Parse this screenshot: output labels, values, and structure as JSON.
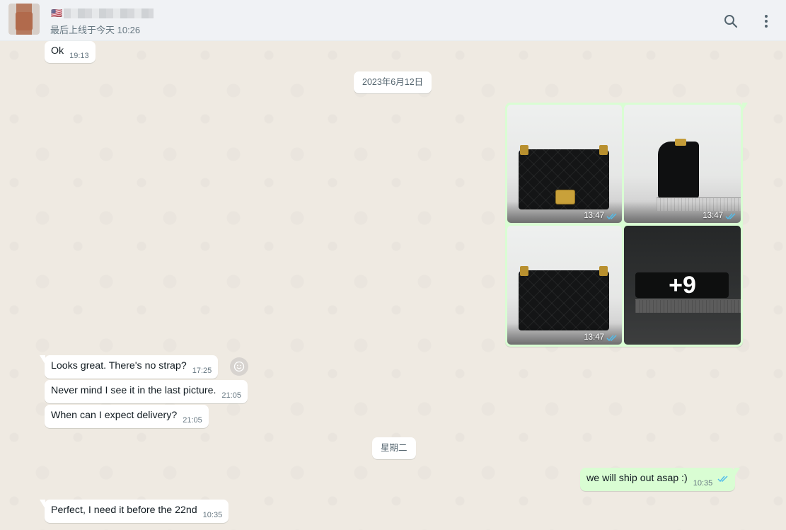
{
  "header": {
    "flag": "🇺🇸",
    "last_seen": "最后上线于今天 10:26"
  },
  "messages": [
    {
      "text": "Ok",
      "time": "19:13"
    },
    {
      "text": "Looks great.  There's no strap?",
      "time": "17:25"
    },
    {
      "text": "Never mind I see it in the last picture.",
      "time": "21:05"
    },
    {
      "text": "When can I expect delivery?",
      "time": "21:05"
    },
    {
      "text": "we will  ship out asap  :)",
      "time": "10:35"
    },
    {
      "text": "Perfect, I need it before the 22nd",
      "time": "10:35"
    }
  ],
  "date_chips": [
    "2023年6月12日",
    "星期二"
  ],
  "album": {
    "photos": [
      {
        "time": "13:47"
      },
      {
        "time": "13:47"
      },
      {
        "time": "13:47"
      }
    ],
    "more_count": "+9"
  },
  "colors": {
    "incoming_bubble": "#ffffff",
    "outgoing_bubble": "#d9fdd3",
    "read_ticks": "#53bdeb",
    "chat_background": "#efeae2"
  },
  "icons": [
    "search-icon",
    "more-vertical-icon",
    "double-check-icon",
    "emoji-reaction-icon"
  ]
}
